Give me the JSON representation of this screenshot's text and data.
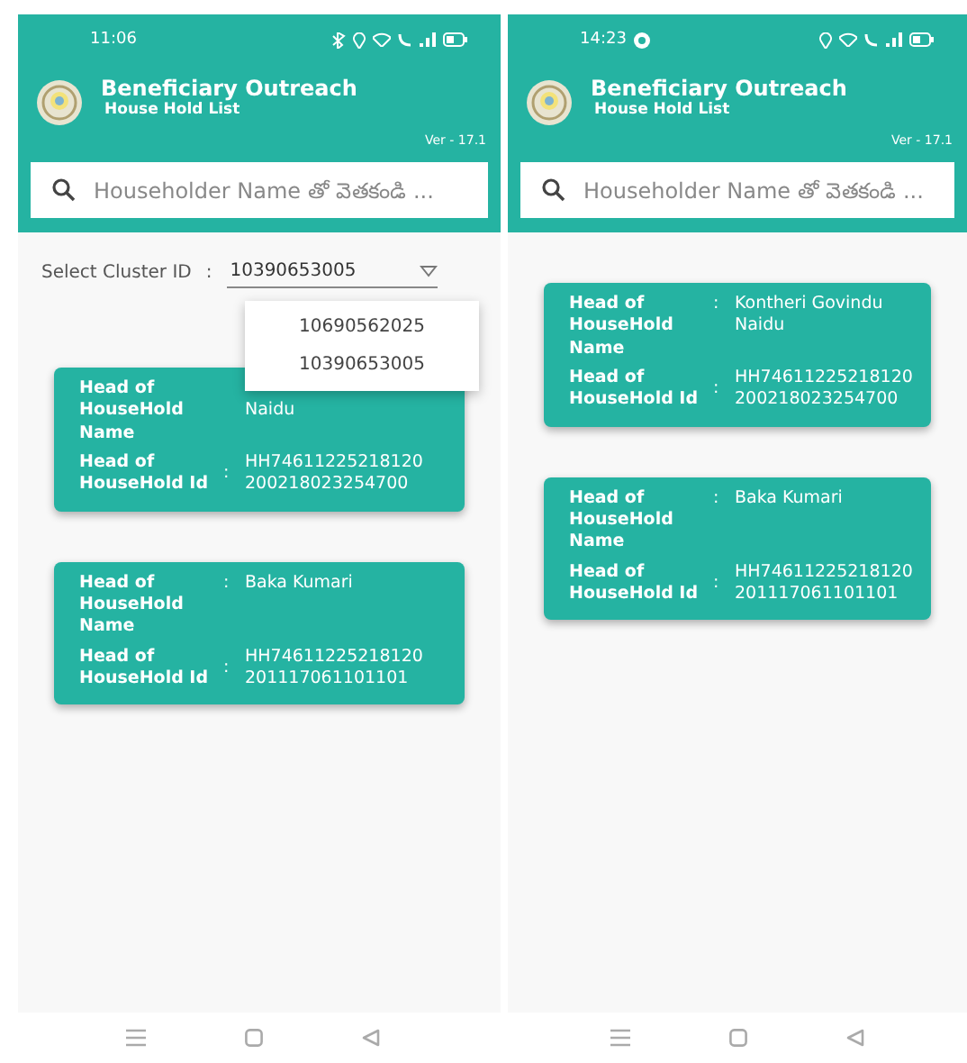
{
  "screens": [
    {
      "status_bar": {
        "time": "11:06",
        "extra_icon": false
      },
      "header": {
        "title": "Beneficiary Outreach",
        "subtitle": "House Hold List",
        "version": "Ver - 17.1"
      },
      "search": {
        "placeholder": "Householder Name తో వెతకండి ..."
      },
      "cluster": {
        "label": "Select Cluster ID",
        "separator": ":",
        "value": "10390653005",
        "menu": {
          "open": true,
          "options": [
            "10690562025",
            "10390653005"
          ]
        }
      },
      "households": [
        {
          "name_label": "Head of HouseHold Name",
          "separator": ":",
          "name": "Naidu",
          "name_partly_hidden": true,
          "id_label": "Head of HouseHold Id",
          "id": "HH74611225218120 200218023254700"
        },
        {
          "name_label": "Head of HouseHold Name",
          "separator": ":",
          "name": "Baka Kumari",
          "name_partly_hidden": false,
          "id_label": "Head of HouseHold Id",
          "id": "HH74611225218120 201117061101101"
        }
      ]
    },
    {
      "status_bar": {
        "time": "14:23",
        "extra_icon": true
      },
      "header": {
        "title": "Beneficiary Outreach",
        "subtitle": "House Hold List",
        "version": "Ver - 17.1"
      },
      "search": {
        "placeholder": "Householder Name తో వెతకండి ..."
      },
      "households": [
        {
          "name_label": "Head of HouseHold Name",
          "separator": ":",
          "name": "Kontheri Govindu Naidu",
          "name_partly_hidden": false,
          "id_label": "Head of HouseHold Id",
          "id": "HH74611225218120 200218023254700"
        },
        {
          "name_label": "Head of HouseHold Name",
          "separator": ":",
          "name": "Baka Kumari",
          "name_partly_hidden": false,
          "id_label": "Head of HouseHold Id",
          "id": "HH74611225218120 201117061101101"
        }
      ]
    }
  ]
}
